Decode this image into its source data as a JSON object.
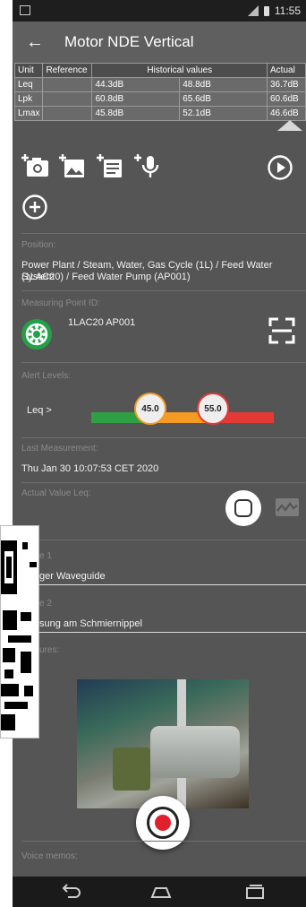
{
  "status_bar": {
    "time": "11:55"
  },
  "app_bar": {
    "title": "Motor NDE Vertical"
  },
  "history_table": {
    "headers": {
      "unit": "Unit",
      "reference": "Reference",
      "historical": "Historical values",
      "actual": "Actual"
    },
    "rows": [
      {
        "unit": "Leq",
        "reference": "",
        "h1": "44.3dB",
        "h2": "48.8dB",
        "actual": "36.7dB"
      },
      {
        "unit": "Lpk",
        "reference": "",
        "h1": "60.8dB",
        "h2": "65.6dB",
        "actual": "60.6dB"
      },
      {
        "unit": "Lmax",
        "reference": "",
        "h1": "45.8dB",
        "h2": "52.1dB",
        "actual": "46.6dB"
      }
    ]
  },
  "position": {
    "label": "Position:",
    "value_line1": "Power Plant / Steam, Water, Gas Cycle (1L) / Feed Water System",
    "value_line2": "(1LAC20) / Feed Water Pump (AP001)"
  },
  "measuring_point": {
    "label": "Measuring Point ID:",
    "value": "1LAC20 AP001"
  },
  "alert_levels": {
    "label": "Alert Levels:",
    "row_label": "Leq >",
    "warning": "45.0",
    "alarm": "55.0",
    "colors": {
      "ok": "#2ea043",
      "warning": "#f59a23",
      "alarm": "#e53935"
    }
  },
  "last_measurement": {
    "label": "Last Measurement:",
    "value": "Thu Jan 30 10:07:53 CET 2020"
  },
  "actual_value": {
    "label": "Actual Value Leq:"
  },
  "field1": {
    "label": "e 1",
    "value": "ger Waveguide"
  },
  "field2": {
    "label": "e 2",
    "value": "sung am Schmiernippel"
  },
  "pictures": {
    "label": "ures:"
  },
  "voice_memos": {
    "label": "Voice memos:"
  },
  "icons": {
    "back": "arrow-left-icon",
    "add_photo": "add-photo-icon",
    "add_image": "add-image-icon",
    "add_note": "add-note-icon",
    "add_voice": "add-voice-icon",
    "play": "play-icon",
    "add": "add-icon",
    "bearing": "bearing-icon",
    "scan": "scan-icon",
    "record": "record-icon",
    "waveform": "waveform-icon"
  }
}
